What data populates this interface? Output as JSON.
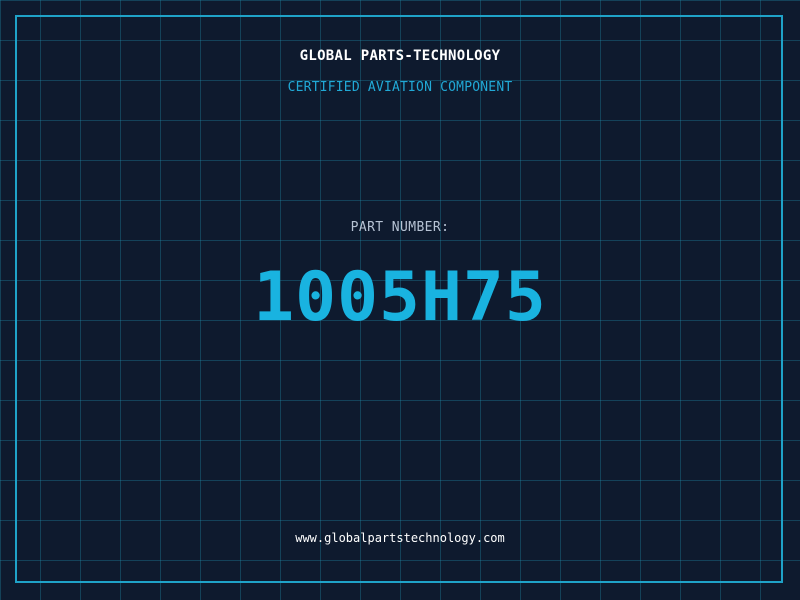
{
  "header": {
    "company": "GLOBAL PARTS-TECHNOLOGY",
    "subtitle": "CERTIFIED AVIATION COMPONENT"
  },
  "part": {
    "label": "PART NUMBER:",
    "number": "1005H75"
  },
  "footer": {
    "website": "www.globalpartstechnology.com"
  },
  "colors": {
    "background": "#0e1a2e",
    "grid": "#208caa",
    "accent": "#1fa2c8",
    "part_number": "#19b3e0"
  }
}
